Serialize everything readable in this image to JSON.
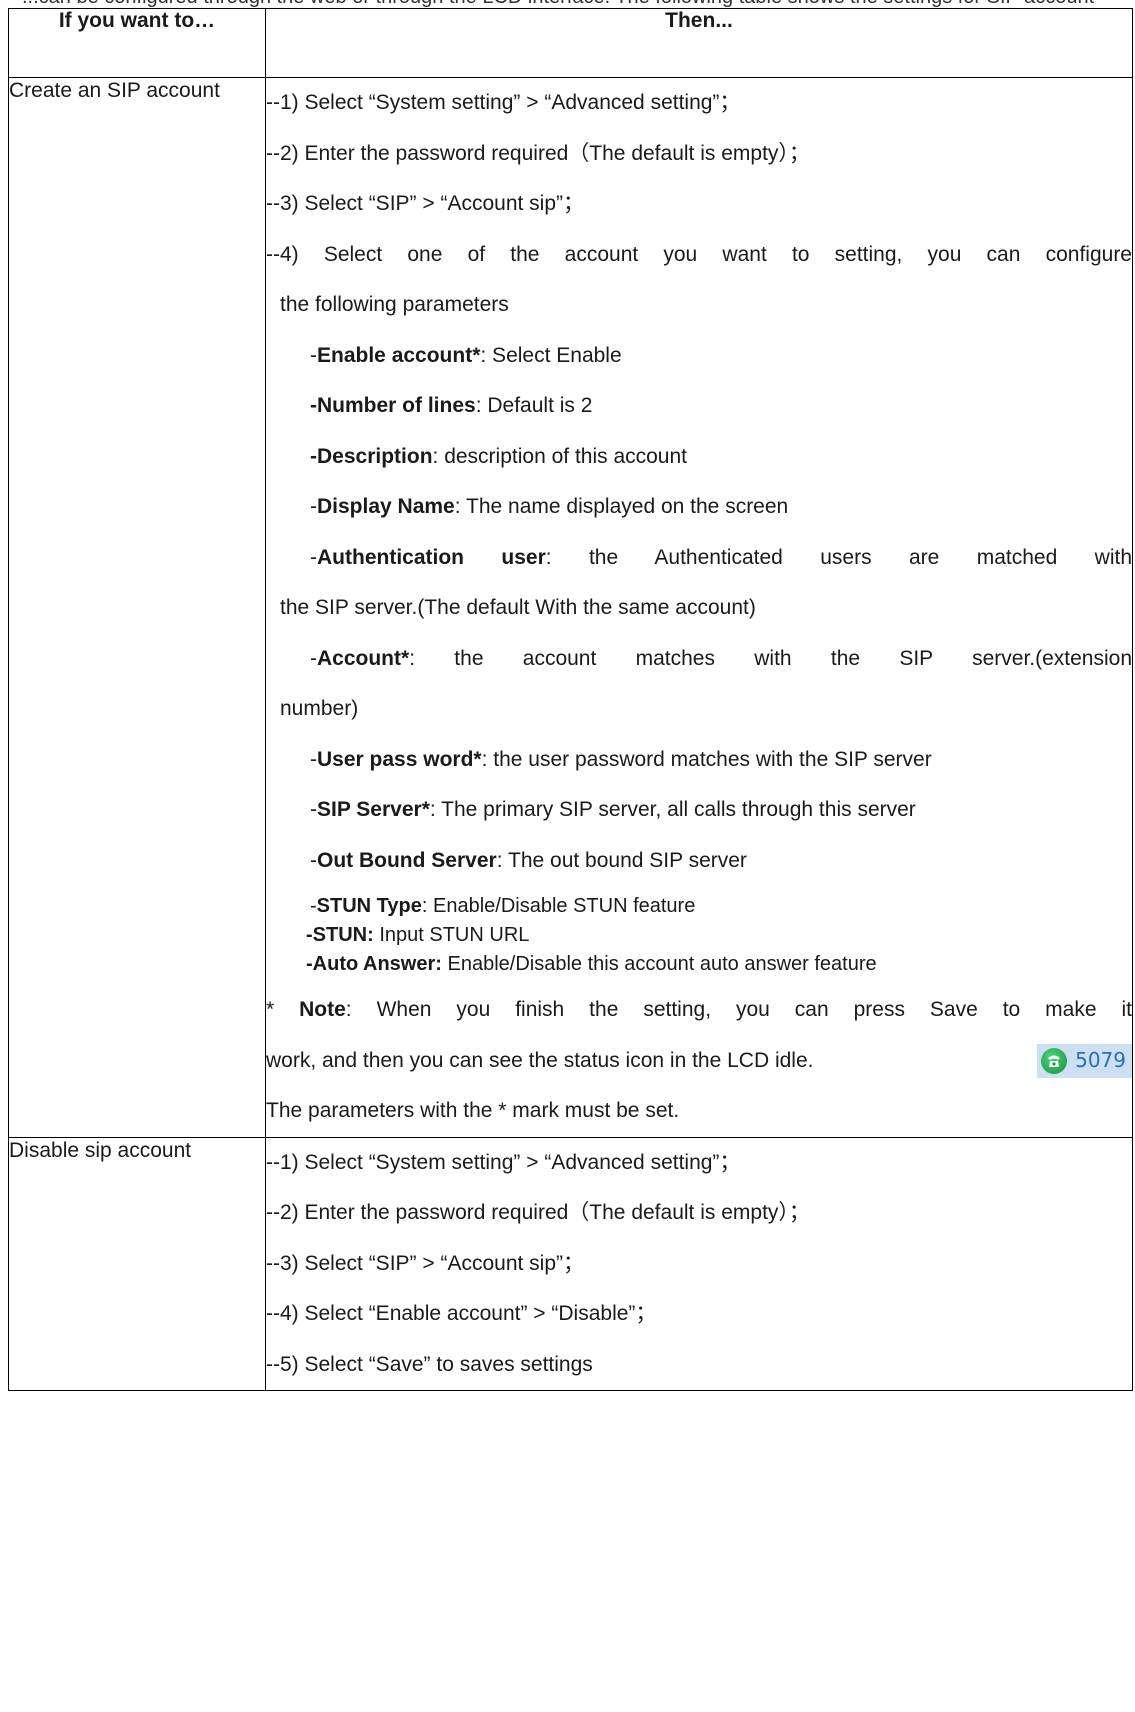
{
  "caption": "...can be configured through the web or through the LCD interface. The following table shows the settings for SIP account",
  "table": {
    "headers": {
      "col1": "If you want to…",
      "col2": "Then..."
    },
    "rows": [
      {
        "action": "Create an SIP account",
        "steps": {
          "s1": "--1) Select “System setting” > “Advanced setting”；",
          "s2": "--2) Enter the password required（The default is empty）；",
          "s3": "--3) Select “SIP” > “Account sip”；",
          "s4a": "--4) Select one of the account you want to setting, you can configure",
          "s4b": "the following parameters",
          "params": [
            {
              "name": "Enable account*",
              "desc": ": Select Enable"
            },
            {
              "name": "Number of lines",
              "desc": ": Default is 2"
            },
            {
              "name": "Description",
              "desc": ": description of this account"
            },
            {
              "name": "Display Name",
              "desc": ": The name displayed on the screen"
            },
            {
              "name": "Authentication user",
              "desc": ": the Authenticated users are matched with",
              "cont": "the SIP server.(The default With the same account)"
            },
            {
              "name": "Account*",
              "desc": ": the account matches with the SIP server.(extension",
              "cont": "number)"
            },
            {
              "name": "User pass word*",
              "desc": ": the user password matches with the SIP server"
            },
            {
              "name": "SIP Server*",
              "desc": ": The primary SIP server, all calls through this server"
            },
            {
              "name": "Out Bound Server",
              "desc": ": The out bound SIP server"
            },
            {
              "name": "STUN Type",
              "desc": ": Enable/Disable STUN feature"
            },
            {
              "name": "STUN:",
              "desc": " Input STUN URL"
            },
            {
              "name": "Auto Answer:",
              "desc": " Enable/Disable this account auto answer feature"
            }
          ],
          "note_prefix": "* ",
          "note_label": "Note",
          "note_line1": ": When you finish the setting, you can press Save to make it",
          "note_line2": "work, and then you can see the status icon in the LCD idle.",
          "status_number": "5079",
          "note_line3": "The parameters with the * mark must be set."
        }
      },
      {
        "action": "Disable sip account",
        "steps": {
          "s1": "--1) Select “System setting” > “Advanced setting”；",
          "s2": "--2) Enter the password required（The default is empty）；",
          "s3": "--3) Select “SIP” > “Account sip”；",
          "s4": "--4) Select “Enable account” > “Disable”；",
          "s5": "--5) Select “Save” to saves settings"
        }
      }
    ]
  },
  "icons": {
    "status": "phone-icon"
  },
  "colors": {
    "border": "#000000",
    "badge_bg": "#cde0f2",
    "icon_green": "#1fae52",
    "number_blue": "#2a6fb3"
  }
}
